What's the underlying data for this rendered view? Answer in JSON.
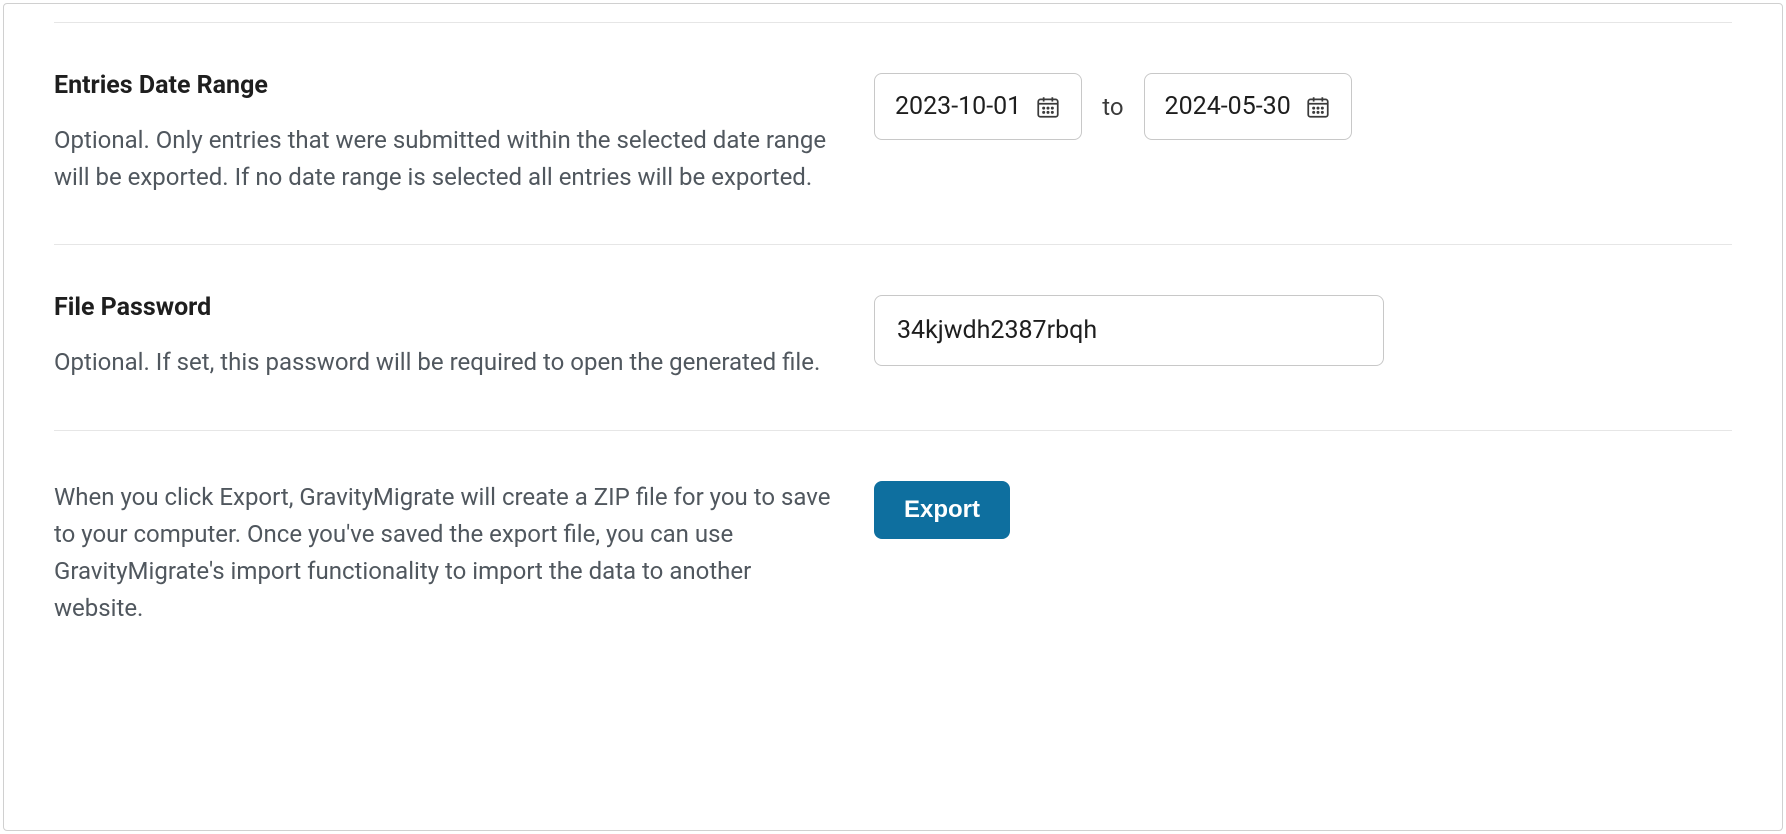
{
  "dateRange": {
    "title": "Entries Date Range",
    "description": "Optional. Only entries that were submitted within the selected date range will be exported. If no date range is selected all entries will be exported.",
    "fromValue": "2023-10-01",
    "separator": "to",
    "toValue": "2024-05-30"
  },
  "filePassword": {
    "title": "File Password",
    "description": "Optional. If set, this password will be required to open the generated file.",
    "value": "34kjwdh2387rbqh"
  },
  "exportSection": {
    "description": "When you click Export, GravityMigrate will create a ZIP file for you to save to your computer. Once you've saved the export file, you can use GravityMigrate's import functionality to import the data to another website.",
    "buttonLabel": "Export"
  }
}
